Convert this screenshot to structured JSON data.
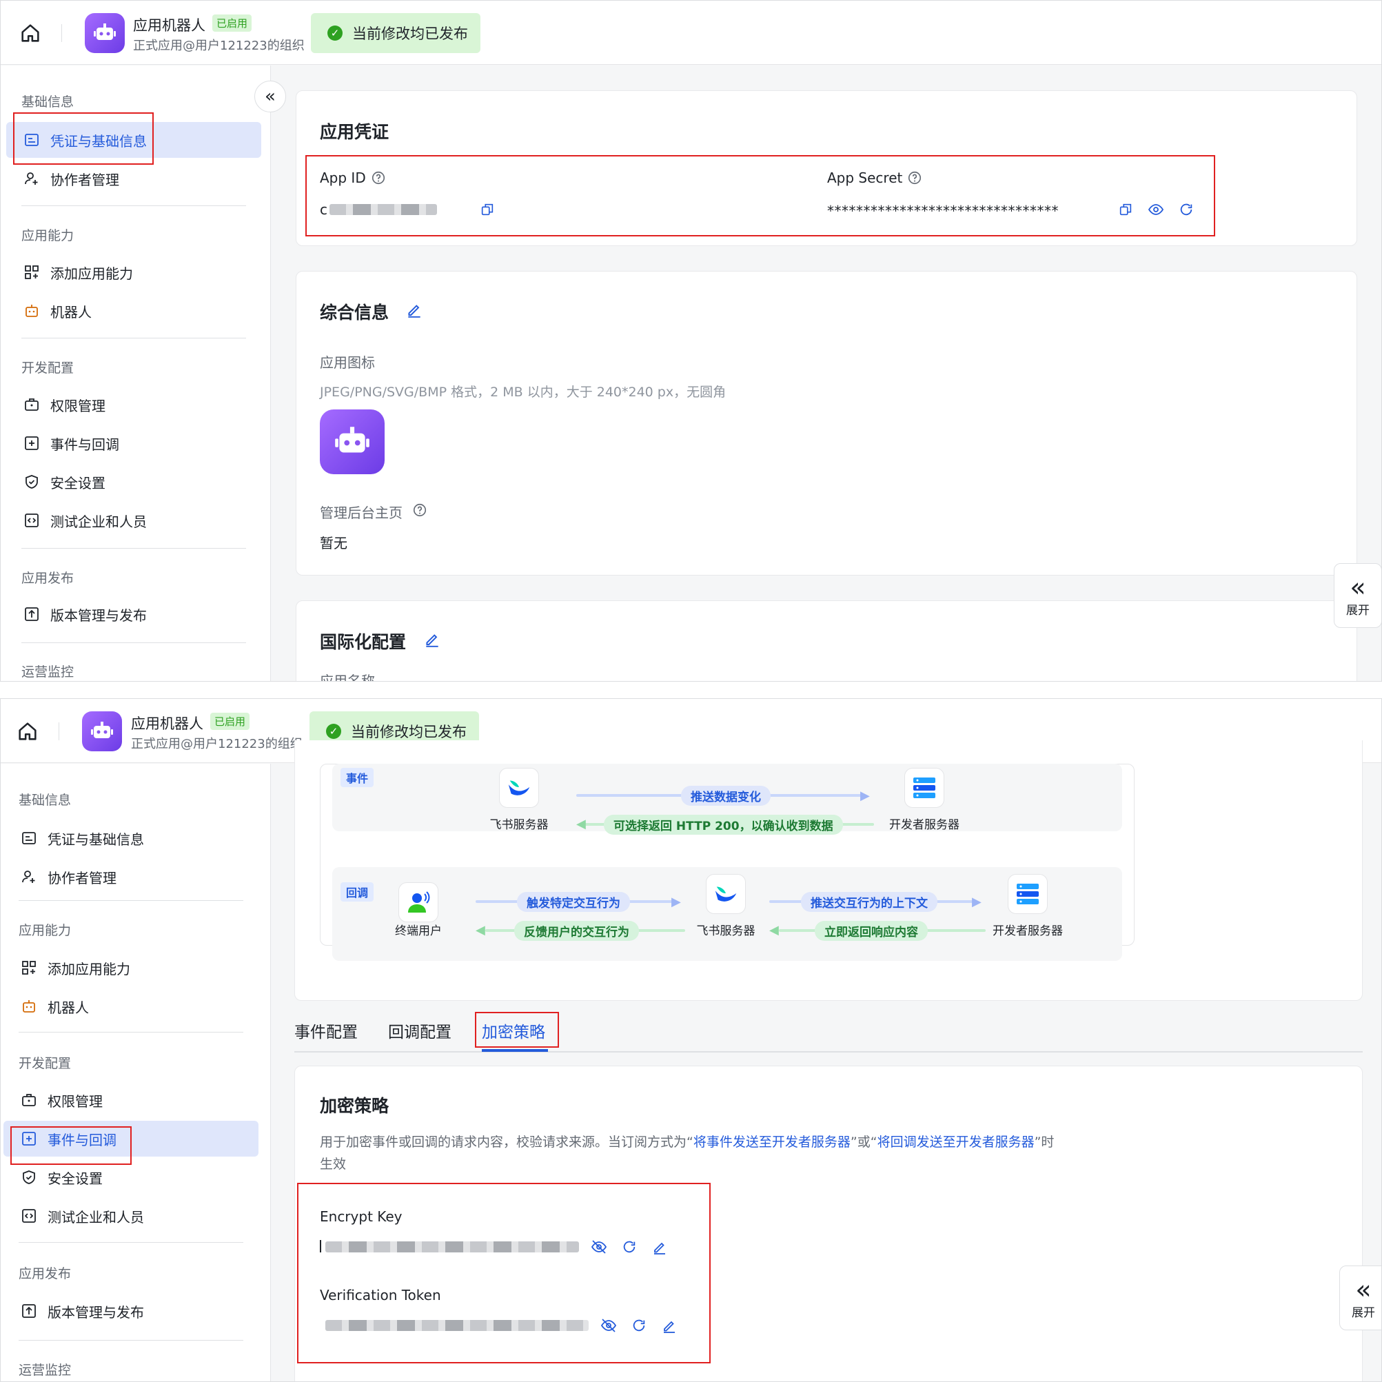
{
  "header": {
    "app_name": "应用机器人",
    "status_badge": "已启用",
    "org": "正式应用@用户121223的组织",
    "publish_status": "当前修改均已发布"
  },
  "sidebar": {
    "sections": [
      {
        "title": "基础信息",
        "items": [
          "凭证与基础信息",
          "协作者管理"
        ]
      },
      {
        "title": "应用能力",
        "items": [
          "添加应用能力",
          "机器人"
        ]
      },
      {
        "title": "开发配置",
        "items": [
          "权限管理",
          "事件与回调",
          "安全设置",
          "测试企业和人员"
        ]
      },
      {
        "title": "应用发布",
        "items": [
          "版本管理与发布"
        ]
      },
      {
        "title": "运营监控",
        "items": []
      }
    ]
  },
  "expand_label": "展开",
  "credentials": {
    "title": "应用凭证",
    "app_id_label": "App ID",
    "app_id_prefix": "c",
    "app_secret_label": "App Secret",
    "app_secret_value": "********************************"
  },
  "general": {
    "title": "综合信息",
    "icon_label": "应用图标",
    "icon_hint": "JPEG/PNG/SVG/BMP 格式，2 MB 以内，大于 240*240 px，无圆角",
    "admin_home_label": "管理后台主页",
    "admin_home_value": "暂无"
  },
  "i18n": {
    "title": "国际化配置",
    "app_name_label": "应用名称"
  },
  "diagram": {
    "event_tag": "事件",
    "feishu_server": "飞书服务器",
    "dev_server": "开发者服务器",
    "push_data_change": "推送数据变化",
    "return_200": "可选择返回 HTTP 200，以确认收到数据",
    "callback_tag": "回调",
    "end_user": "终端用户",
    "trigger_action": "触发特定交互行为",
    "feedback_action": "反馈用户的交互行为",
    "push_context": "推送交互行为的上下文",
    "return_response": "立即返回响应内容"
  },
  "tabs": [
    "事件配置",
    "回调配置",
    "加密策略"
  ],
  "encryption": {
    "title": "加密策略",
    "desc_1": "用于加密事件或回调的请求内容，校验请求来源。当订阅方式为“",
    "desc_link1": "将事件发送至开发者服务器",
    "desc_2": "”或“",
    "desc_link2": "将回调发送至开发者服务器",
    "desc_3": "”时",
    "desc_4": "生效",
    "encrypt_key_label": "Encrypt Key",
    "verification_token_label": "Verification Token"
  },
  "colors": {
    "accent": "#245bdb",
    "active_bg": "#dfe6fb",
    "success": "#2ea121",
    "highlight_box": "#e02020"
  }
}
